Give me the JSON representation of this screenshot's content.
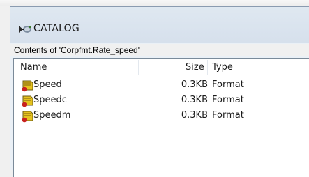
{
  "window": {
    "title": "CATALOG",
    "icon": "catalog-icon"
  },
  "contents_label": "Contents of 'Corpfmt.Rate_speed'",
  "list": {
    "columns": {
      "name": "Name",
      "size": "Size",
      "type": "Type"
    },
    "rows": [
      {
        "icon": "format-file-icon",
        "name": "Speed",
        "size": "0.3KB",
        "type": "Format"
      },
      {
        "icon": "format-file-icon",
        "name": "Speedc",
        "size": "0.3KB",
        "type": "Format"
      },
      {
        "icon": "format-file-icon",
        "name": "Speedm",
        "size": "0.3KB",
        "type": "Format"
      }
    ]
  },
  "colors": {
    "titlebar": "#dfe8f1",
    "list_background": "#ffffff",
    "icon_yellow": "#e5c21f",
    "icon_red": "#c8211e"
  }
}
